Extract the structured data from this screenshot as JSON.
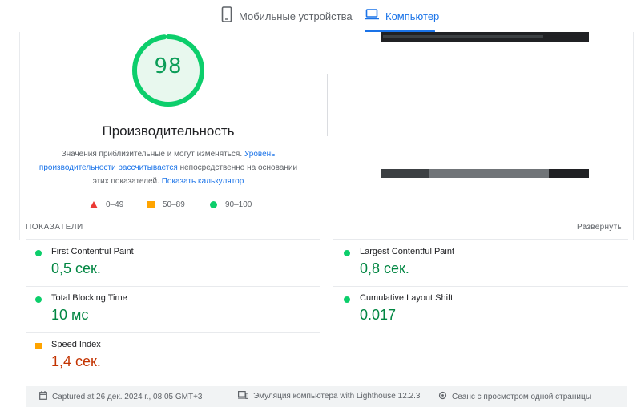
{
  "tabs": {
    "mobile": {
      "label": "Мобильные устройства",
      "icon": "smartphone-icon"
    },
    "desktop": {
      "label": "Компьютер",
      "icon": "laptop-icon",
      "selected": true
    }
  },
  "score": {
    "value": "98",
    "fraction": 0.98,
    "color": "#0cce6b",
    "title": "Производительность",
    "desc_part1": "Значения приблизительные и могут изменяться. ",
    "desc_link1": "Уровень производительности рассчитывается",
    "desc_part2": " непосредственно на основании этих показателей. ",
    "desc_link2": "Показать калькулятор"
  },
  "legend": [
    {
      "range": "0–49",
      "shape": "triangle",
      "color": "#eb3a34"
    },
    {
      "range": "50–89",
      "shape": "square",
      "color": "#ffa400"
    },
    {
      "range": "90–100",
      "shape": "circle",
      "color": "#0cce6b"
    }
  ],
  "metrics_section": {
    "header": "ПОКАЗАТЕЛИ",
    "expand_label": "Развернуть",
    "items": [
      {
        "name": "First Contentful Paint",
        "value": "0,5 сек.",
        "status": "good"
      },
      {
        "name": "Largest Contentful Paint",
        "value": "0,8 сек.",
        "status": "good"
      },
      {
        "name": "Total Blocking Time",
        "value": "10 мс",
        "status": "good"
      },
      {
        "name": "Cumulative Layout Shift",
        "value": "0.017",
        "status": "good"
      },
      {
        "name": "Speed Index",
        "value": "1,4 сек.",
        "status": "average"
      }
    ]
  },
  "footer": {
    "captured": "Captured at 26 дек. 2024 г., 08:05 GMT+3",
    "emulation": "Эмуляция компьютера with Lighthouse 12.2.3",
    "session": "Сеанс с просмотром одной страницы"
  }
}
